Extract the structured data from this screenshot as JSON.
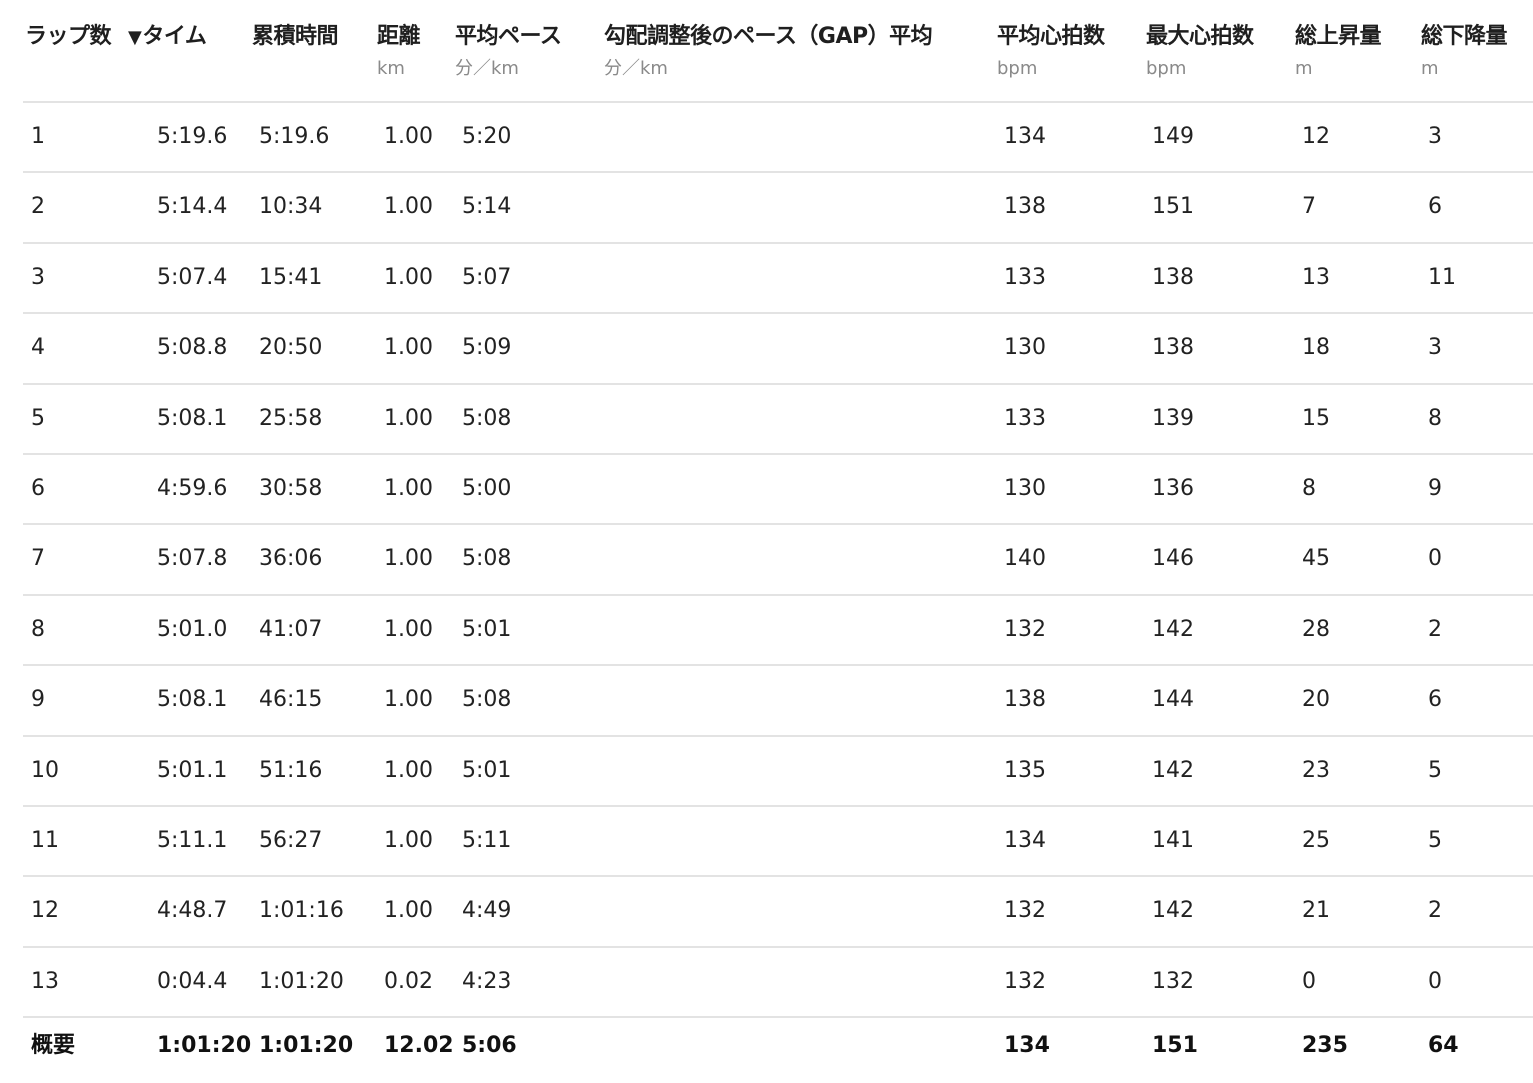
{
  "headers": {
    "lap": "ラップ数",
    "time": "タイム",
    "time_sort_icon": "▼",
    "cumulative": "累積時間",
    "distance": "距離",
    "distance_unit": "km",
    "avg_pace": "平均ペース",
    "avg_pace_unit": "分／km",
    "gap": "勾配調整後のペース（GAP）平均",
    "gap_unit": "分／km",
    "avg_hr": "平均心拍数",
    "avg_hr_unit": "bpm",
    "max_hr": "最大心拍数",
    "max_hr_unit": "bpm",
    "ascent": "総上昇量",
    "ascent_unit": "m",
    "descent": "総下降量",
    "descent_unit": "m"
  },
  "rows": [
    {
      "lap": "1",
      "time": "5:19.6",
      "cumulative": "5:19.6",
      "distance": "1.00",
      "avg_pace": "5:20",
      "gap": "",
      "avg_hr": "134",
      "max_hr": "149",
      "ascent": "12",
      "descent": "3"
    },
    {
      "lap": "2",
      "time": "5:14.4",
      "cumulative": "10:34",
      "distance": "1.00",
      "avg_pace": "5:14",
      "gap": "",
      "avg_hr": "138",
      "max_hr": "151",
      "ascent": "7",
      "descent": "6"
    },
    {
      "lap": "3",
      "time": "5:07.4",
      "cumulative": "15:41",
      "distance": "1.00",
      "avg_pace": "5:07",
      "gap": "",
      "avg_hr": "133",
      "max_hr": "138",
      "ascent": "13",
      "descent": "11"
    },
    {
      "lap": "4",
      "time": "5:08.8",
      "cumulative": "20:50",
      "distance": "1.00",
      "avg_pace": "5:09",
      "gap": "",
      "avg_hr": "130",
      "max_hr": "138",
      "ascent": "18",
      "descent": "3"
    },
    {
      "lap": "5",
      "time": "5:08.1",
      "cumulative": "25:58",
      "distance": "1.00",
      "avg_pace": "5:08",
      "gap": "",
      "avg_hr": "133",
      "max_hr": "139",
      "ascent": "15",
      "descent": "8"
    },
    {
      "lap": "6",
      "time": "4:59.6",
      "cumulative": "30:58",
      "distance": "1.00",
      "avg_pace": "5:00",
      "gap": "",
      "avg_hr": "130",
      "max_hr": "136",
      "ascent": "8",
      "descent": "9"
    },
    {
      "lap": "7",
      "time": "5:07.8",
      "cumulative": "36:06",
      "distance": "1.00",
      "avg_pace": "5:08",
      "gap": "",
      "avg_hr": "140",
      "max_hr": "146",
      "ascent": "45",
      "descent": "0"
    },
    {
      "lap": "8",
      "time": "5:01.0",
      "cumulative": "41:07",
      "distance": "1.00",
      "avg_pace": "5:01",
      "gap": "",
      "avg_hr": "132",
      "max_hr": "142",
      "ascent": "28",
      "descent": "2"
    },
    {
      "lap": "9",
      "time": "5:08.1",
      "cumulative": "46:15",
      "distance": "1.00",
      "avg_pace": "5:08",
      "gap": "",
      "avg_hr": "138",
      "max_hr": "144",
      "ascent": "20",
      "descent": "6"
    },
    {
      "lap": "10",
      "time": "5:01.1",
      "cumulative": "51:16",
      "distance": "1.00",
      "avg_pace": "5:01",
      "gap": "",
      "avg_hr": "135",
      "max_hr": "142",
      "ascent": "23",
      "descent": "5"
    },
    {
      "lap": "11",
      "time": "5:11.1",
      "cumulative": "56:27",
      "distance": "1.00",
      "avg_pace": "5:11",
      "gap": "",
      "avg_hr": "134",
      "max_hr": "141",
      "ascent": "25",
      "descent": "5"
    },
    {
      "lap": "12",
      "time": "4:48.7",
      "cumulative": "1:01:16",
      "distance": "1.00",
      "avg_pace": "4:49",
      "gap": "",
      "avg_hr": "132",
      "max_hr": "142",
      "ascent": "21",
      "descent": "2"
    },
    {
      "lap": "13",
      "time": "0:04.4",
      "cumulative": "1:01:20",
      "distance": "0.02",
      "avg_pace": "4:23",
      "gap": "",
      "avg_hr": "132",
      "max_hr": "132",
      "ascent": "0",
      "descent": "0"
    }
  ],
  "summary": {
    "label": "概要",
    "time": "1:01:20",
    "cumulative": "1:01:20",
    "distance": "12.02",
    "avg_pace": "5:06",
    "gap": "",
    "avg_hr": "134",
    "max_hr": "151",
    "ascent": "235",
    "descent": "64"
  }
}
